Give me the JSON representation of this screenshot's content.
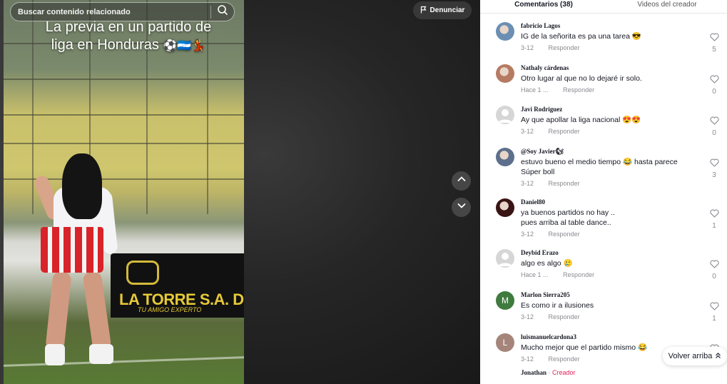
{
  "search": {
    "placeholder": "Buscar contenido relacionado"
  },
  "video": {
    "caption_line1": "La previa en un partido de",
    "caption_line2": "liga en Honduras",
    "caption_emojis": "⚽🇭🇳💃",
    "banner_text": "LA TORRE S.A. DE C.V.",
    "banner_subtext": "TU AMIGO EXPERTO"
  },
  "actions": {
    "report_label": "Denunciar"
  },
  "tabs": {
    "comments": "Comentarios (38)",
    "creator_videos": "Videos del creador"
  },
  "reply_label": "Responder",
  "comments": [
    {
      "user": "fabricio Lagos",
      "text": "IG de la señorita es pa una tarea 😎",
      "date": "3-12",
      "likes": "5",
      "avatar_color": "#6b8fb3"
    },
    {
      "user": "Nathaly cárdenas",
      "text": "Otro lugar al que no lo dejaré ir solo.",
      "date": "Hace 1 ...",
      "likes": "0",
      "avatar_color": "#b57b62"
    },
    {
      "user": "Javi Rodriguez",
      "text": "Ay que apollar la liga nacional 😍😍",
      "date": "3-12",
      "likes": "0",
      "avatar_color": "#d6d6d6"
    },
    {
      "user": "@Soy Javier🐿",
      "text": "estuvo bueno el medio tiempo 😂 hasta parece Súper boll",
      "date": "3-12",
      "likes": "3",
      "avatar_color": "#5d6f8c"
    },
    {
      "user": "Daniel80",
      "text": "ya buenos partidos no hay ..\npues arriba al table dance..",
      "date": "3-12",
      "likes": "1",
      "avatar_color": "#3a1414"
    },
    {
      "user": "Deybid Erazo",
      "text": "algo es algo 🥲",
      "date": "Hace 1 ...",
      "likes": "0",
      "avatar_color": "#d6d6d6"
    },
    {
      "user": "Marlon Sierra205",
      "text": "Es como ir a ilusiones",
      "date": "3-12",
      "likes": "1",
      "avatar_color": "#3f7a3f",
      "initial": "M"
    },
    {
      "user": "luismanuelcardona3",
      "text": "Mucho mejor que el partido mismo 😂",
      "date": "3-12",
      "likes": "",
      "avatar_color": "#a5847a",
      "initial": "L"
    }
  ],
  "partial_reply": {
    "user": "Jonathan",
    "sep": " · ",
    "tag": "Creador"
  },
  "back_to_top": "Volver arriba",
  "colors": {
    "creator_tag": "#e0245e",
    "text_primary": "#161823",
    "text_secondary": "#8a8b91"
  }
}
